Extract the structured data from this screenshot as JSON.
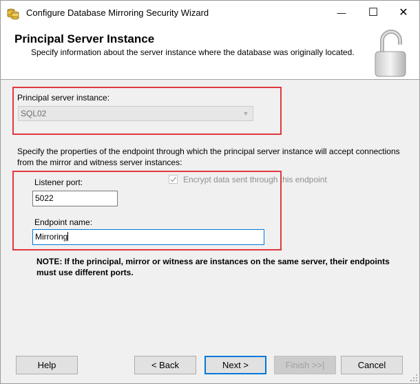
{
  "window": {
    "title": "Configure Database Mirroring Security Wizard",
    "minimize_glyph": "—",
    "maximize_glyph": "☐",
    "close_glyph": "✕",
    "app_icon": "database-wizard-icon"
  },
  "header": {
    "title": "Principal Server Instance",
    "subtitle": "Specify information about the server instance where the database was originally located.",
    "icon": "padlock-icon"
  },
  "principal": {
    "label": "Principal server instance:",
    "value": "SQL02",
    "disabled": true
  },
  "endpoint_description": "Specify the properties of the endpoint through which the principal server instance will accept connections from the mirror and witness server instances:",
  "listener_port": {
    "label": "Listener port:",
    "value": "5022"
  },
  "encrypt": {
    "label": "Encrypt data sent through this endpoint",
    "checked": true,
    "disabled": true
  },
  "endpoint_name": {
    "label": "Endpoint name:",
    "value": "Mirroring"
  },
  "note": "NOTE: If the principal, mirror or witness are instances on the same server, their endpoints must use different ports.",
  "buttons": {
    "help": "Help",
    "back": "< Back",
    "next": "Next >",
    "finish": "Finish >>|",
    "cancel": "Cancel"
  },
  "colors": {
    "highlight": "#e0373d",
    "focus": "#0078d7"
  }
}
